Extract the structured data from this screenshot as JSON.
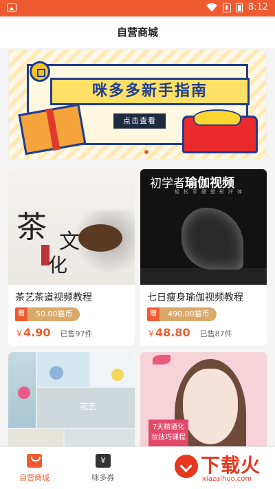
{
  "status_bar": {
    "time": "8:12"
  },
  "header": {
    "title": "自营商城"
  },
  "banner": {
    "title": "咪多多新手指南",
    "cta": "点击查看"
  },
  "products": [
    {
      "name": "茶艺茶道视频教程",
      "gift_tag": "赠",
      "coins": "50.00猫币",
      "currency": "￥",
      "price": "4.90",
      "sold": "已售97件",
      "image_text": {
        "big": "茶",
        "mid": "文",
        "low": "化"
      }
    },
    {
      "name": "七日瘦身瑜伽视频教程",
      "gift_tag": "赠",
      "coins": "490.00猫币",
      "currency": "￥",
      "price": "48.80",
      "sold": "已售87件",
      "image_text": {
        "title_a": "初学者",
        "title_b": "瑜伽视频",
        "subtitle": "轻松享瘦塑形纤体"
      }
    },
    {
      "name": "",
      "image_text": {
        "caption": "花艺"
      }
    },
    {
      "name": "",
      "image_text": {
        "caption": "7天精通化妆技巧课程"
      }
    }
  ],
  "tabbar": {
    "tabs": [
      {
        "label": "自营商城",
        "active": true
      },
      {
        "label": "咪多券",
        "active": false
      },
      {
        "label": "",
        "active": false
      },
      {
        "label": "",
        "active": false
      }
    ]
  },
  "watermark": {
    "brand": "下载火",
    "url": "xiazaihuo.com"
  },
  "colors": {
    "accent": "#f05a30",
    "coin_pill": "#d9a96a",
    "watermark": "#e8371f"
  }
}
